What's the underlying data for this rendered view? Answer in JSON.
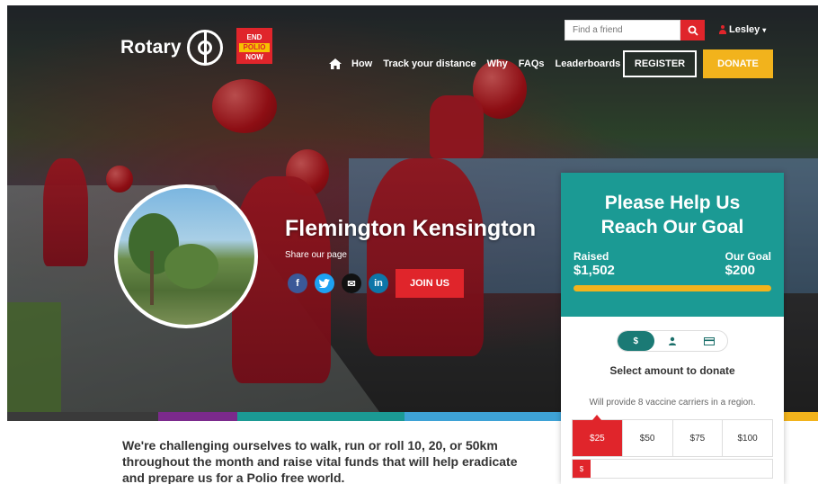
{
  "header": {
    "logo_text": "Rotary",
    "end_polio": [
      "END",
      "POLIO",
      "NOW"
    ],
    "search": {
      "placeholder": "Find a friend"
    },
    "user": {
      "name": "Lesley"
    },
    "nav": {
      "items": [
        "How",
        "Track your distance",
        "Why",
        "FAQs",
        "Leaderboards"
      ]
    },
    "register_label": "REGISTER",
    "donate_label": "DONATE"
  },
  "hero": {
    "title": "Flemington Kensington",
    "share_label": "Share our page",
    "join_label": "JOIN US",
    "socials": [
      "f",
      "t",
      "✉",
      "in"
    ]
  },
  "colorbar": [
    "#3a3a3a",
    "#7b2a8c",
    "#1b9a94",
    "#3ea2d6",
    "#f2b31c"
  ],
  "donation": {
    "title_line1": "Please Help Us",
    "title_line2": "Reach Our Goal",
    "raised_label": "Raised",
    "raised_value": "$1,502",
    "goal_label": "Our Goal",
    "goal_value": "$200",
    "toggle": [
      "$",
      "☺",
      "▬"
    ],
    "select_title": "Select amount to donate",
    "provide_text": "Will provide 8 vaccine carriers in a region.",
    "amounts": [
      "$25",
      "$50",
      "$75",
      "$100"
    ],
    "selected_amount": "$25",
    "currency_symbol": "$"
  },
  "intro_text": "We're challenging ourselves to walk, run or roll 10, 20, or 50km throughout the month and raise vital funds that will help eradicate and prepare us for a Polio free world.",
  "colors": {
    "brand_red": "#e0252b",
    "teal": "#1b9a94",
    "gold": "#f2b31c"
  }
}
